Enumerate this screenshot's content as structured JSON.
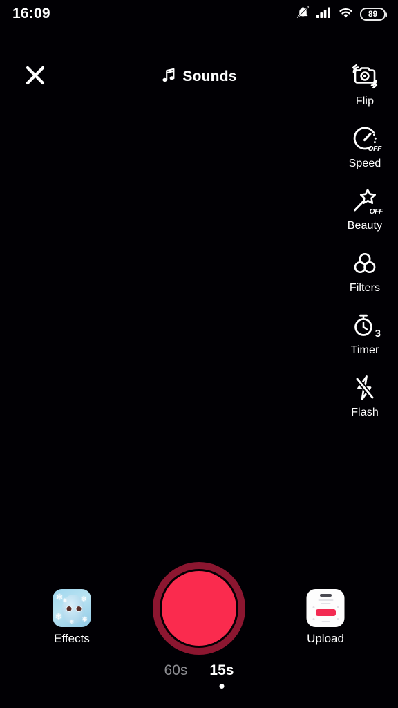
{
  "status_bar": {
    "time": "16:09",
    "battery_level": "89",
    "icons": [
      "notifications-muted-icon",
      "cellular-signal-icon",
      "wifi-icon",
      "battery-icon"
    ]
  },
  "top_bar": {
    "close_label": "close-icon",
    "sounds_label": "Sounds",
    "sounds_icon": "music-note-icon"
  },
  "tool_rail": {
    "items": [
      {
        "label": "Flip",
        "icon": "camera-flip-icon",
        "badge": ""
      },
      {
        "label": "Speed",
        "icon": "speedometer-icon",
        "badge": "OFF"
      },
      {
        "label": "Beauty",
        "icon": "magic-wand-icon",
        "badge": "OFF"
      },
      {
        "label": "Filters",
        "icon": "filters-rings-icon",
        "badge": ""
      },
      {
        "label": "Timer",
        "icon": "stopwatch-icon",
        "badge": "3"
      },
      {
        "label": "Flash",
        "icon": "flash-off-icon",
        "badge": ""
      }
    ]
  },
  "bottom_controls": {
    "effects_label": "Effects",
    "upload_label": "Upload",
    "record_label": "record-button"
  },
  "duration_selector": {
    "options": [
      {
        "label": "60s",
        "selected": false
      },
      {
        "label": "15s",
        "selected": true
      }
    ]
  },
  "colors": {
    "background": "#010004",
    "record_inner": "#fa2b4e",
    "record_ring": "#8c1630",
    "text_primary": "#ffffff",
    "text_inactive": "#8b8b90",
    "effects_thumb": "#9fd6ee",
    "upload_cta": "#f32b52"
  }
}
